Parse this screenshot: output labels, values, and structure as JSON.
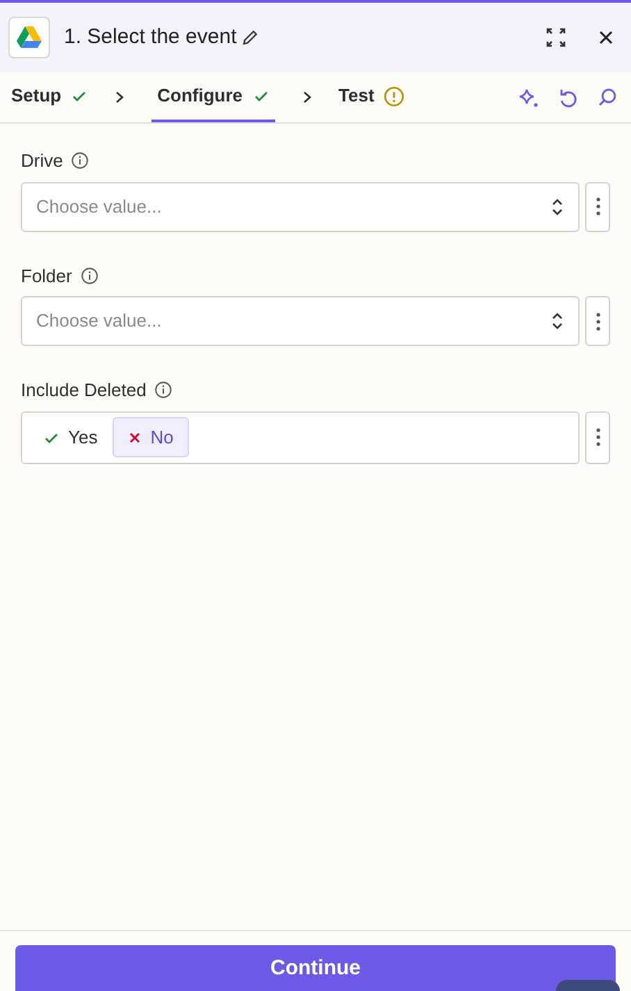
{
  "header": {
    "title": "1. Select the event"
  },
  "steps": [
    {
      "label": "Setup",
      "selected": false,
      "kind": "done"
    },
    {
      "label": "Configure",
      "selected": true,
      "kind": "done"
    },
    {
      "label": "Test",
      "selected": false,
      "kind": "warning"
    }
  ],
  "fields": [
    {
      "kind": "select",
      "label": "Drive",
      "placeholder": "Choose value..."
    },
    {
      "kind": "select",
      "label": "Folder",
      "placeholder": "Choose value..."
    },
    {
      "kind": "toggle",
      "label": "Include Deleted",
      "options": [
        {
          "label": "Yes",
          "selected": false,
          "kind": "yes"
        },
        {
          "label": "No",
          "selected": true,
          "kind": "no"
        }
      ]
    }
  ],
  "footer": {
    "button": "Continue"
  }
}
